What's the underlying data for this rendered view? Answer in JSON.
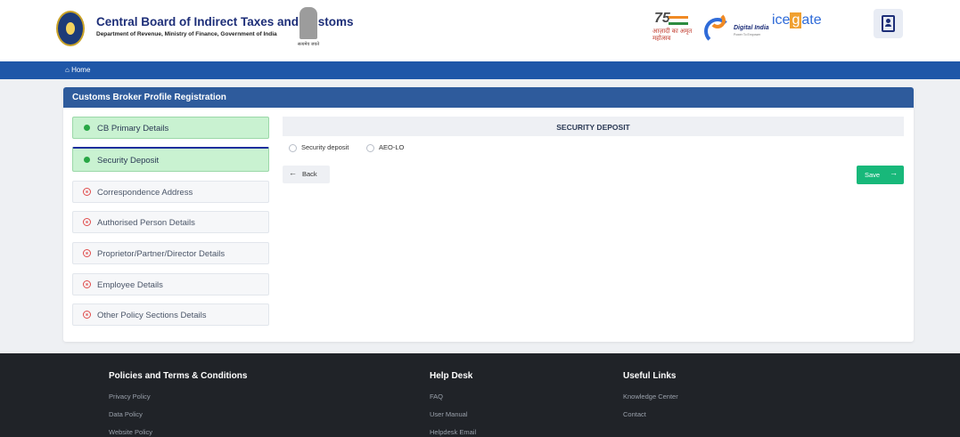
{
  "header": {
    "org_title": "Central Board of Indirect Taxes and Customs",
    "org_subtitle": "Department of Revenue, Ministry of Finance, Government of India",
    "emblem_motto": "सत्यमेव जयते",
    "azadi_number": "75",
    "azadi_text": "आज़ादी का अमृत महोत्सव",
    "digital_india": "Digital India",
    "digital_india_tagline": "Power To Empower",
    "icegate_parts": [
      "ice",
      "g",
      "ate"
    ],
    "icons": {
      "emblem": "cbic-emblem-icon",
      "ashoka": "ashoka-emblem-icon",
      "profile": "profile-card-icon"
    }
  },
  "nav": {
    "home_label": "Home",
    "home_icon": "⌂"
  },
  "card": {
    "title": "Customs Broker Profile Registration",
    "steps": [
      {
        "label": "CB Primary Details",
        "status": "done"
      },
      {
        "label": "Security Deposit",
        "status": "active"
      },
      {
        "label": "Correspondence Address",
        "status": "pending"
      },
      {
        "label": "Authorised Person Details",
        "status": "pending"
      },
      {
        "label": "Proprietor/Partner/Director Details",
        "status": "pending"
      },
      {
        "label": "Employee Details",
        "status": "pending"
      },
      {
        "label": "Other Policy Sections Details",
        "status": "pending"
      }
    ],
    "section_title": "SECURITY DEPOSIT",
    "radio_options": [
      "Security deposit",
      "AEO-LO"
    ],
    "back_label": "Back",
    "back_arrow": "←",
    "save_label": "Save",
    "save_arrow": "→"
  },
  "footer": {
    "columns": [
      {
        "title": "Policies and Terms & Conditions",
        "links": [
          "Privacy Policy",
          "Data Policy",
          "Website Policy"
        ]
      },
      {
        "title": "Help Desk",
        "links": [
          "FAQ",
          "User Manual",
          "Helpdesk Email"
        ]
      },
      {
        "title": "Useful Links",
        "links": [
          "Knowledge Center",
          "Contact"
        ]
      }
    ]
  },
  "colors": {
    "nav_blue": "#1f57a8",
    "card_header": "#2e5b9c",
    "done_green": "#c9f2d1",
    "save_green": "#18b87a",
    "footer_bg": "#202328"
  }
}
